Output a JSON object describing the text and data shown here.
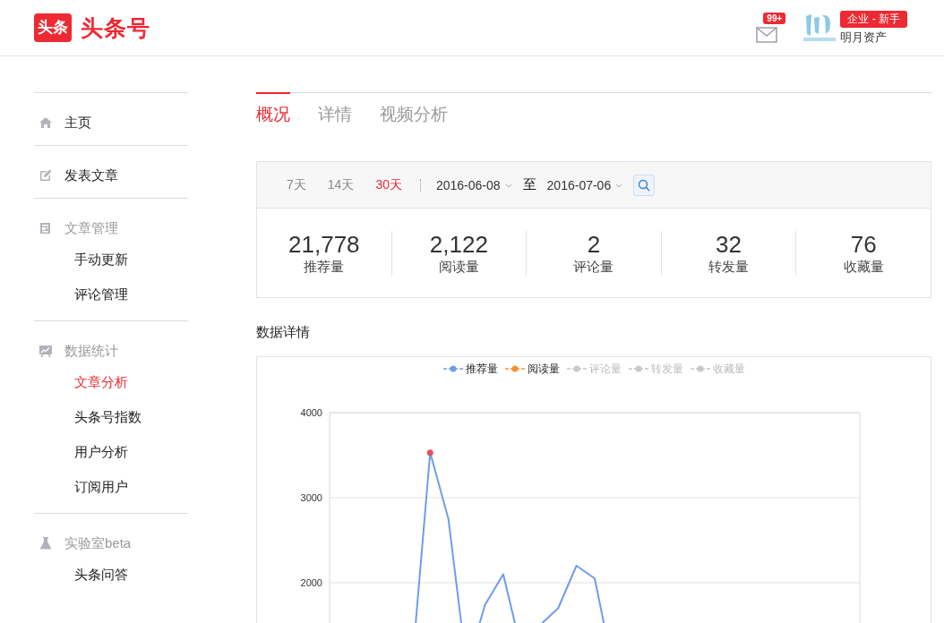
{
  "header": {
    "logo_mark": "头条",
    "logo_title": "头条号",
    "mail_badge": "99+",
    "account_tag": "企业 - 新手",
    "account_name": "明月资产"
  },
  "sidebar": [
    {
      "kind": "link",
      "label": "主页",
      "selected": false
    },
    {
      "kind": "link",
      "label": "发表文章",
      "selected": false
    },
    {
      "kind": "group",
      "label": "文章管理",
      "selected": false,
      "children": [
        {
          "label": "手动更新",
          "selected": false
        },
        {
          "label": "评论管理",
          "selected": false
        }
      ]
    },
    {
      "kind": "group",
      "label": "数据统计",
      "selected": false,
      "children": [
        {
          "label": "文章分析",
          "selected": true
        },
        {
          "label": "头条号指数",
          "selected": false
        },
        {
          "label": "用户分析",
          "selected": false
        },
        {
          "label": "订阅用户",
          "selected": false
        }
      ]
    },
    {
      "kind": "group",
      "label": "实验室beta",
      "selected": false,
      "children": [
        {
          "label": "头条问答",
          "selected": false
        }
      ]
    }
  ],
  "tabs": [
    {
      "label": "概况",
      "selected": true
    },
    {
      "label": "详情",
      "selected": false
    },
    {
      "label": "视频分析",
      "selected": false
    }
  ],
  "filter": {
    "ranges": [
      {
        "label": "7天",
        "selected": false
      },
      {
        "label": "14天",
        "selected": false
      },
      {
        "label": "30天",
        "selected": true
      }
    ],
    "start_date": "2016-06-08",
    "separator": "至",
    "end_date": "2016-07-06"
  },
  "stats": [
    {
      "value": "21,778",
      "label": "推荐量"
    },
    {
      "value": "2,122",
      "label": "阅读量"
    },
    {
      "value": "2",
      "label": "评论量"
    },
    {
      "value": "32",
      "label": "转发量"
    },
    {
      "value": "76",
      "label": "收藏量"
    }
  ],
  "details_title": "数据详情",
  "legend_states": [
    {
      "enabled": true
    },
    {
      "enabled": true
    },
    {
      "enabled": false
    },
    {
      "enabled": false
    },
    {
      "enabled": false
    }
  ],
  "highlight_point": {
    "color": "#e8505b"
  },
  "chart_data": {
    "type": "line",
    "ylim": [
      0,
      4000
    ],
    "yticks": [
      2000,
      3000,
      4000
    ],
    "series": [
      {
        "name": "推荐量",
        "color": "#6f9ceb",
        "values": [
          null,
          null,
          null,
          null,
          1000,
          3530,
          2750,
          1000,
          1740,
          2100,
          1200,
          1500,
          1700,
          2200,
          2050,
          1000,
          null,
          null,
          null,
          null,
          null,
          null,
          null,
          null,
          null,
          null,
          null,
          null,
          null
        ]
      },
      {
        "name": "阅读量",
        "color": "#f5922f"
      },
      {
        "name": "评论量"
      },
      {
        "name": "转发量"
      },
      {
        "name": "收藏量"
      }
    ]
  }
}
